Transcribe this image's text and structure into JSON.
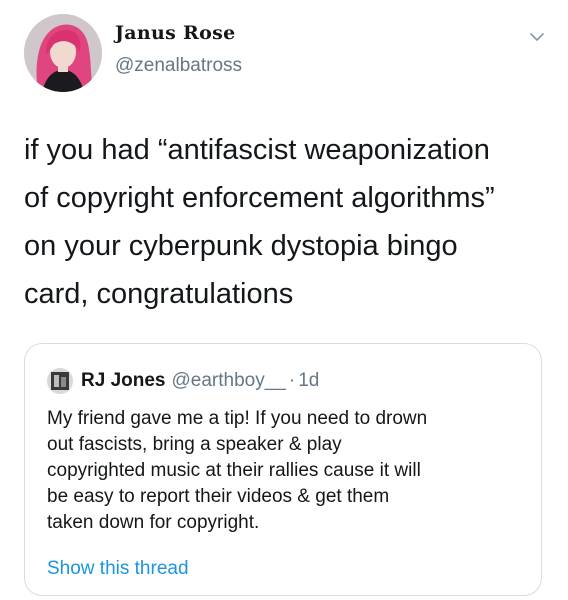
{
  "tweet": {
    "author": {
      "display_name": "Janus Rose",
      "handle": "@zenalbatross"
    },
    "text_lines": [
      "if you had “antifascist weaponization",
      "of copyright enforcement algorithms”",
      "on your cyberpunk dystopia bingo",
      "card, congratulations"
    ],
    "menu_icon": "chevron-down-icon"
  },
  "quoted_tweet": {
    "author": {
      "display_name": "RJ Jones",
      "handle": "@earthboy__",
      "separator": "·",
      "time": "1d"
    },
    "text_lines": [
      "My friend gave me a tip! If you need to drown",
      "out fascists, bring a speaker & play",
      "copyrighted music at their rallies cause it will",
      "be easy to report their videos & get them",
      "taken down for copyright."
    ],
    "show_thread_label": "Show this thread"
  },
  "colors": {
    "text": "#14171a",
    "secondary": "#657786",
    "link": "#1b95e0",
    "border": "#d7dde2"
  }
}
